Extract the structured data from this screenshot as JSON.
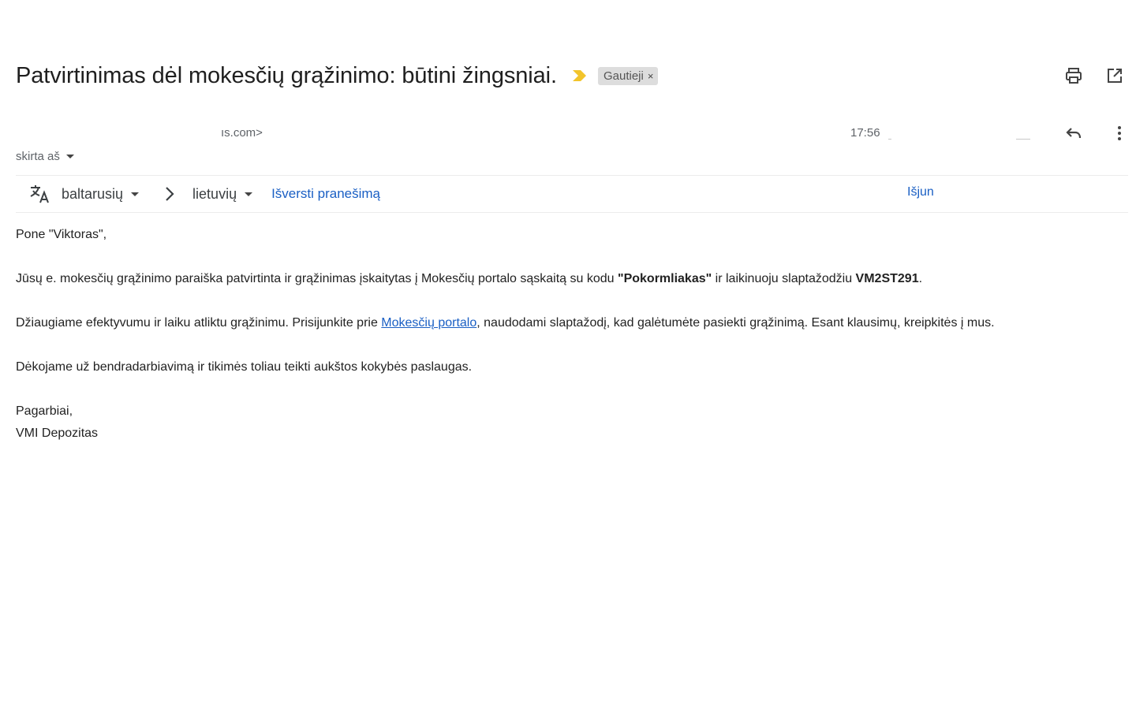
{
  "email": {
    "subject": "Patvirtinimas dėl mokesčių grąžinimo: būtini žingsniai.",
    "label": "Gautieji",
    "label_remove": "×",
    "sender_email_fragment": "ıs.com>",
    "time": "17:56",
    "to_label": "skirta aš"
  },
  "translate": {
    "from_lang": "baltarusių",
    "to_lang": "lietuvių",
    "translate_link": "Išversti pranešimą",
    "turn_off": "Išjun"
  },
  "body": {
    "greeting": "Pone \"Viktoras\",",
    "p1_before": "Jūsų e. mokesčių grąžinimo paraiška patvirtinta ir grąžinimas įskaitytas į Mokesčių portalo sąskaitą su kodu ",
    "p1_code": "\"Pokormliakas\"",
    "p1_middle": " ir laikinuoju slaptažodžiu ",
    "p1_password": "VM2ST291",
    "p1_end": ".",
    "p2_before": "Džiaugiame efektyvumu ir laiku atliktu grąžinimu. Prisijunkite prie ",
    "p2_link": "Mokesčių portalo",
    "p2_after": ", naudodami slaptažodį, kad galėtumėte pasiekti grąžinimą. Esant klausimų, kreipkitės į mus.",
    "p3": "Dėkojame už bendradarbiavimą ir tikimės toliau teikti aukštos kokybės paslaugas.",
    "closing": "Pagarbiai,",
    "signature": "VMI Depozitas"
  },
  "icons": {
    "importance": "importance-marker-icon",
    "print": "print-icon",
    "open_new": "open-in-new-window-icon",
    "reply": "reply-icon",
    "more": "more-vertical-icon",
    "translate": "translate-icon",
    "chevron": "chevron-right-icon"
  },
  "colors": {
    "importance": "#f2c42b",
    "link": "#1a5fc4",
    "label_bg": "#dddddd"
  }
}
